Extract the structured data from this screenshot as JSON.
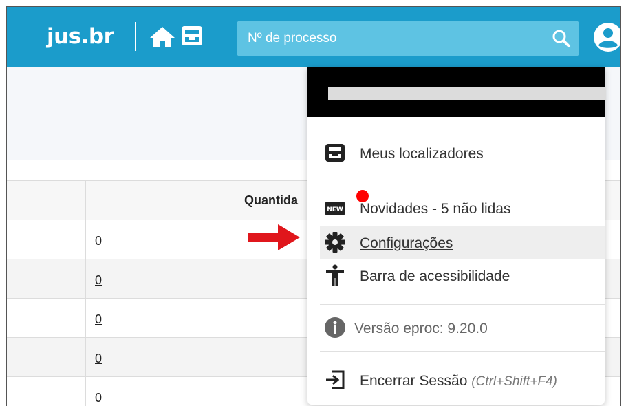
{
  "header": {
    "brand": "jus.br",
    "search": {
      "placeholder": "Nº de processo"
    }
  },
  "table": {
    "column_header": "Quantida",
    "rows": [
      {
        "count": "0"
      },
      {
        "count": "0"
      },
      {
        "count": "0"
      },
      {
        "count": "0"
      },
      {
        "count": "0"
      }
    ]
  },
  "user_menu": {
    "items": [
      {
        "label": "Meus localizadores",
        "icon": "locator-tray-icon"
      },
      {
        "label": "Novidades - 5 não lidas",
        "icon": "new-badge-icon"
      },
      {
        "label": "Configurações",
        "icon": "gear-icon"
      },
      {
        "label": "Barra de acessibilidade",
        "icon": "accessibility-icon"
      }
    ],
    "version": {
      "label": "Versão eproc: 9.20.0",
      "icon": "info-icon"
    },
    "logout": {
      "label": "Encerrar Sessão",
      "shortcut": "(Ctrl+Shift+F4)",
      "icon": "logout-icon"
    }
  },
  "colors": {
    "topbar": "#1b9ccb",
    "search_bg": "#5ec3e3",
    "arrow": "#e0161c",
    "notification_dot": "#ff0000"
  }
}
